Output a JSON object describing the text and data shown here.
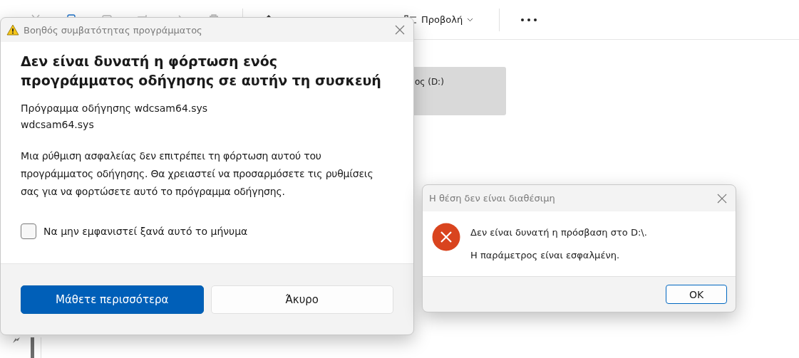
{
  "explorer": {
    "toolbar": {
      "view_button": {
        "label": "Προβολή"
      }
    },
    "drive_tile": {
      "label": "ος (D:)"
    }
  },
  "compatibility_dialog": {
    "title": "Βοηθός συμβατότητας προγράμματος",
    "heading": "Δεν είναι δυνατή η φόρτωση ενός προγράμματος οδήγησης σε αυτήν τη συσκευή",
    "driver_lines": [
      "Πρόγραμμα οδήγησης wdcsam64.sys",
      "wdcsam64.sys"
    ],
    "message": "Μια ρύθμιση ασφαλείας δεν επιτρέπει τη φόρτωση αυτού του προγράμματος οδήγησης. Θα χρειαστεί να προσαρμόσετε τις ρυθμίσεις σας για να φορτώσετε αυτό το πρόγραμμα οδήγησης.",
    "checkbox": {
      "label": "Να μην εμφανιστεί ξανά αυτό το μήνυμα",
      "checked": false
    },
    "buttons": [
      {
        "label": "Μάθετε περισσότερα",
        "kind": "primary"
      },
      {
        "label": "Άκυρο",
        "kind": "secondary"
      }
    ]
  },
  "error_dialog": {
    "title": "Η θέση δεν είναι διαθέσιμη",
    "lines": [
      "Δεν είναι δυνατή η πρόσβαση στο D:\\.",
      "Η παράμετρος είναι εσφαλμένη."
    ],
    "button": "OK"
  }
}
